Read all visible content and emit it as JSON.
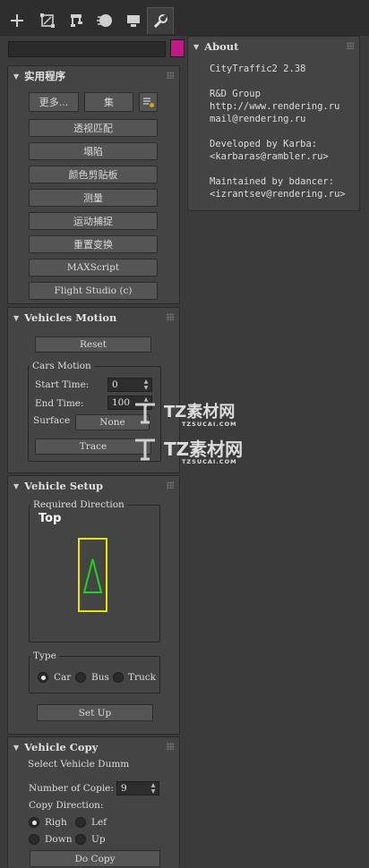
{
  "tabs": [
    {
      "icon": "plus-icon"
    },
    {
      "icon": "modify-icon"
    },
    {
      "icon": "hierarchy-icon"
    },
    {
      "icon": "motion-icon"
    },
    {
      "icon": "display-icon"
    },
    {
      "icon": "utilities-icon",
      "active": true
    }
  ],
  "name_field": {
    "value": ""
  },
  "colors": {
    "swatch": "#c21a84",
    "panel": "#444444",
    "background": "#3b3b3b",
    "triangle": "#22d322",
    "frame": "#e6e600"
  },
  "utilities": {
    "title": "实用程序",
    "more_label": "更多...",
    "sets_label": "集",
    "items": [
      "透视匹配",
      "塌陷",
      "颜色剪贴板",
      "测量",
      "运动捕捉",
      "重置变换",
      "MAXScript",
      "Flight Studio (c)"
    ]
  },
  "vehicles_motion": {
    "title": "Vehicles Motion",
    "reset_label": "Reset",
    "group_label": "Cars Motion",
    "start_label": "Start Time:",
    "start_value": "0",
    "end_label": "End Time:",
    "end_value": "100",
    "surface_label": "Surface",
    "surface_value": "None",
    "trace_label": "Trace"
  },
  "vehicle_setup": {
    "title": "Vehicle Setup",
    "direction_label": "Required Direction",
    "view_label": "Top",
    "type_label": "Type",
    "types": [
      {
        "label": "Car",
        "selected": true
      },
      {
        "label": "Bus",
        "selected": false
      },
      {
        "label": "Truck",
        "selected": false
      }
    ],
    "setup_label": "Set Up"
  },
  "vehicle_copy": {
    "title": "Vehicle Copy",
    "select_label": "Select Vehicle Dumm",
    "copies_label": "Number of Copie:",
    "copies_value": "9",
    "direction_label": "Copy Direction:",
    "directions": [
      {
        "label": "Righ",
        "selected": true
      },
      {
        "label": "Lef",
        "selected": false
      },
      {
        "label": "Down",
        "selected": false
      },
      {
        "label": "Up",
        "selected": false
      }
    ],
    "do_copy_label": "Do Copy"
  },
  "about": {
    "title": "About",
    "line1": "CityTraffic2 2.38",
    "line2": "R&D Group",
    "line3": "http://www.rendering.ru",
    "line4": "mail@rendering.ru",
    "line5": "Developed by Karba:",
    "line6": "<karbaras@rambler.ru>",
    "line7": "Maintained by bdancer:",
    "line8": "<izrantsev@rendering.ru>"
  },
  "watermark": {
    "brand": "TZ素材网",
    "site": "TZSUCAI.COM"
  }
}
